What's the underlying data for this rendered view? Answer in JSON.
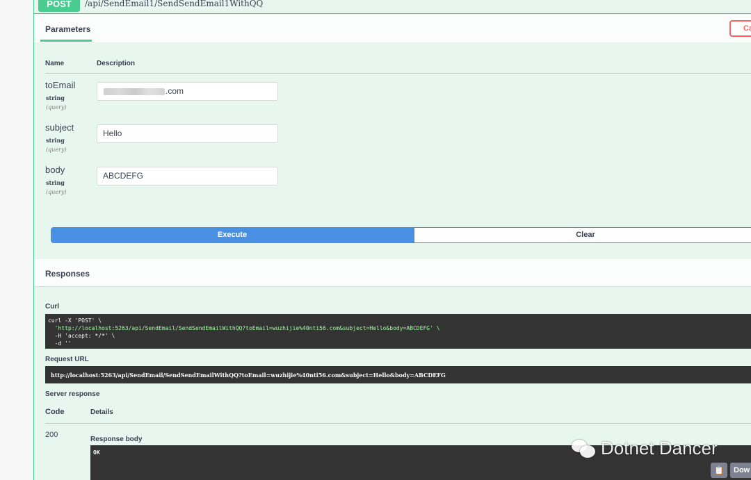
{
  "operation": {
    "method": "POST",
    "path": "/api/SendEmail1/SendSendEmail1WithQQ"
  },
  "parameters": {
    "title": "Parameters",
    "cancel_label": "Ca",
    "col_name": "Name",
    "col_description": "Description",
    "items": [
      {
        "name": "toEmail",
        "type": "string",
        "in": "(query)",
        "value": ".com"
      },
      {
        "name": "subject",
        "type": "string",
        "in": "(query)",
        "value": "Hello"
      },
      {
        "name": "body",
        "type": "string",
        "in": "(query)",
        "value": "ABCDEFG"
      }
    ]
  },
  "actions": {
    "execute_label": "Execute",
    "clear_label": "Clear"
  },
  "responses": {
    "title": "Responses",
    "curl_label": "Curl",
    "curl_lines": [
      "curl -X 'POST' \\",
      "  'http://localhost:5263/api/SendEmail/SendSendEmailWithQQ?toEmail=wuzhijie%40nti56.com&subject=Hello&body=ABCDEFG' \\",
      "  -H 'accept: */*' \\",
      "  -d ''"
    ],
    "request_url_label": "Request URL",
    "request_url": "http://localhost:5263/api/SendEmail/SendSendEmailWithQQ?toEmail=wuzhijie%40nti56.com&subject=Hello&body=ABCDEFG",
    "server_response_label": "Server response",
    "col_code": "Code",
    "col_details": "Details",
    "code": "200",
    "response_body_label": "Response body",
    "response_body": "OK",
    "download_label": "Dow"
  },
  "watermark": {
    "text": "Dotnet Dancer"
  },
  "colors": {
    "post_green": "#49cc90",
    "execute_blue": "#4990e2",
    "cancel_red": "#ff6060",
    "code_bg": "#333333"
  }
}
